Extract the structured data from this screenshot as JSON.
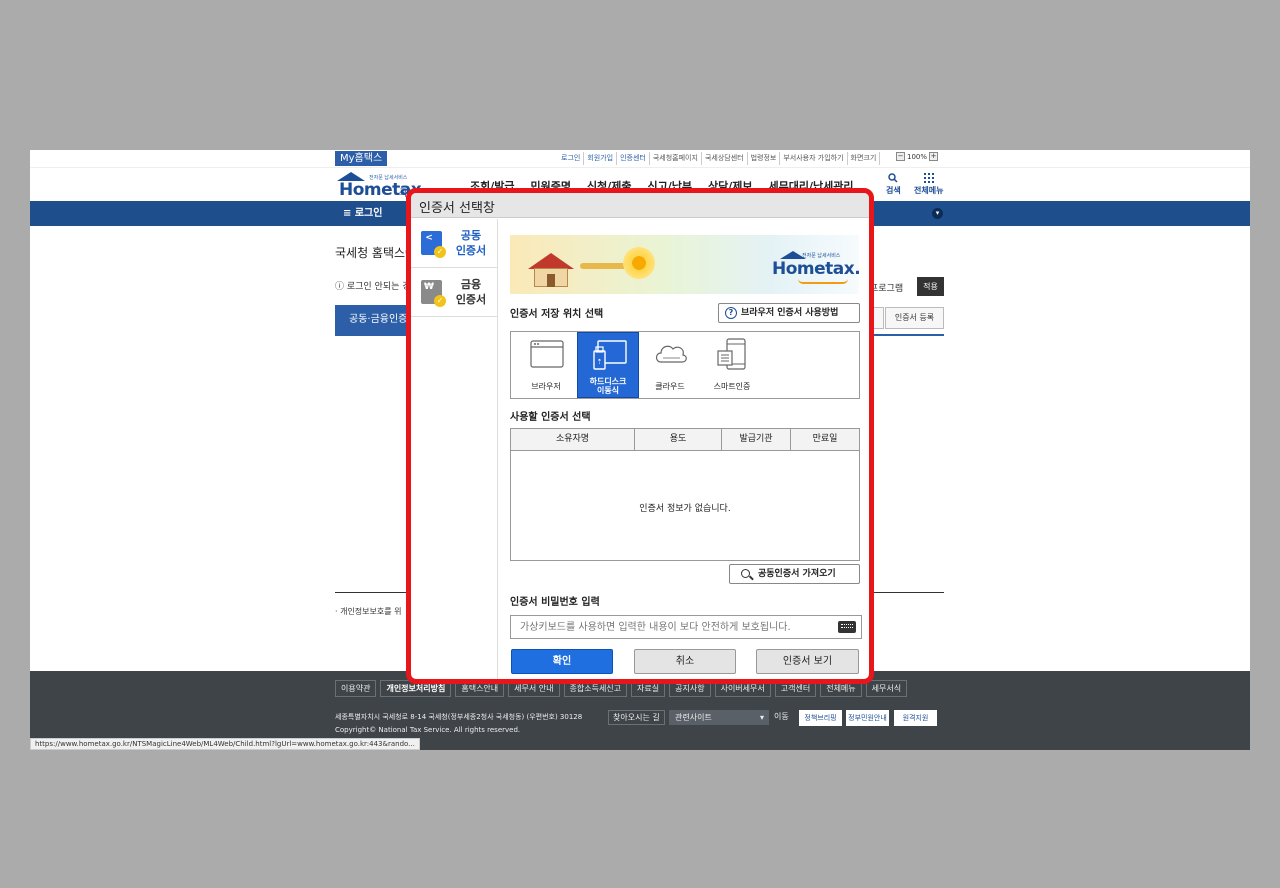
{
  "background_page": {
    "util_bar": {
      "my_badge": "My홈택스",
      "links": [
        "로그인",
        "회원가입",
        "인증센터",
        "국세청홈페이지",
        "국세상담센터",
        "법령정보",
        "부서사용자 가입하기",
        "화면크기"
      ],
      "zoom_level": "100%"
    },
    "logo": {
      "brand": "Hometax.",
      "org": "국세청홈택스",
      "tagline": "전자문 납세서비스"
    },
    "menu": [
      "조회/발급",
      "민원증명",
      "신청/제출",
      "신고/납부",
      "상담/제보",
      "세무대리/납세관리"
    ],
    "search_label": "검색",
    "allmenu_label": "전체메뉴",
    "nav_login": "≡  로그인",
    "content": {
      "title": "국세청 홈택스에",
      "notice": "ⓘ 로그인 안되는 경",
      "program_label": "프로그램",
      "apply_button": "적용",
      "tab_active": "공동·금융인증",
      "register_button": "인증서 등록",
      "privacy": "· 개인정보보호를 위"
    },
    "footer": {
      "links": [
        "이용약관",
        "개인정보처리방침",
        "홈택스안내",
        "세무서 안내",
        "종합소득세신고",
        "자료실",
        "공지사항",
        "사이버세무서",
        "고객센터",
        "전체메뉴",
        "세무서식"
      ],
      "address": "세종특별자치시 국세청로 8-14 국세청(정부세종2청사 국세청동) (우편번호) 30128",
      "directions": "찾아오시는 길",
      "related_select": "관련사이트",
      "go": "이동",
      "badges": [
        "정책브리핑",
        "정부민원안내",
        "원격지원"
      ],
      "copyright": "Copyright© National Tax Service. All rights reserved."
    },
    "status_url": "https://www.hometax.go.kr/NTSMagicLine4Web/ML4Web/Child.html?lgUrl=www.hometax.go.kr:443&rando..."
  },
  "dialog": {
    "title": "인증서 선택창",
    "sidebar": [
      {
        "label": "공동\n인증서",
        "line1": "공동",
        "line2": "인증서",
        "active": true,
        "icon": "share-cert-icon"
      },
      {
        "label": "금융\n인증서",
        "line1": "금융",
        "line2": "인증서",
        "active": false,
        "icon": "won-cert-icon"
      }
    ],
    "banner": {
      "brand": "Hometax.",
      "tagline": "전자문 납세서비스"
    },
    "storage_label": "인증서 저장 위치 선택",
    "help_button": "브라우저 인증서 사용방법",
    "locations": [
      {
        "label": "브라우저",
        "icon": "browser-icon",
        "selected": false
      },
      {
        "label": "하드디스크\n이동식",
        "line1": "하드디스크",
        "line2": "이동식",
        "icon": "usb-disk-icon",
        "selected": true
      },
      {
        "label": "클라우드",
        "icon": "cloud-icon",
        "selected": false
      },
      {
        "label": "스마트인증",
        "icon": "smartphone-icon",
        "selected": false
      }
    ],
    "cert_select_label": "사용할 인증서 선택",
    "table": {
      "columns": [
        "소유자명",
        "용도",
        "발급기관",
        "만료일"
      ],
      "rows": [],
      "empty_message": "인증서 정보가 없습니다."
    },
    "import_button": "공동인증서 가져오기",
    "password_label": "인증서 비밀번호 입력",
    "password_placeholder": "가상키보드를 사용하면 입력한 내용이 보다 안전하게 보호됩니다.",
    "buttons": {
      "ok": "확인",
      "cancel": "취소",
      "view": "인증서 보기"
    },
    "colors": {
      "accent": "#1f6fe0",
      "highlight_border": "#e8151b",
      "selected_location": "#2468d6"
    }
  }
}
